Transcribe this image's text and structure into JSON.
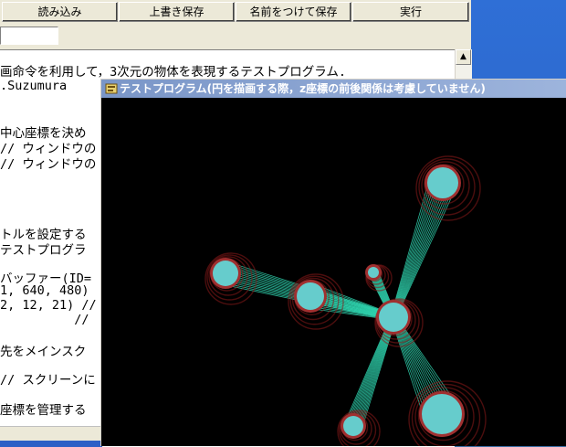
{
  "toolbar": {
    "load": "読み込み",
    "overwrite_save": "上書き保存",
    "save_as": "名前をつけて保存",
    "run": "実行"
  },
  "editor_lines": [
    "画命令を利用して，3次元の物体を表現するテストプログラム.",
    ".Suzumura",
    "",
    "",
    "中心座標を決め",
    "// ウィンドウの",
    "// ウィンドウの",
    "",
    "",
    "",
    "",
    "トルを設定する",
    "テストプログラ",
    "",
    "バッファー(ID=",
    "1, 640, 480)",
    "2, 12, 21) //",
    "          //",
    "",
    "先をメインスク",
    "",
    "// スクリーンに",
    "",
    "座標を管理する"
  ],
  "program_window": {
    "title": "テストプログラム(円を描画する際，z座標の前後関係は考慮していません)"
  },
  "icons": {
    "program": "program-icon",
    "scroll_up": "scroll-up-arrow-icon"
  },
  "colors": {
    "sphere_core": "#66cccc",
    "sphere_halo": "#8b1a1a",
    "lines": "#2fd6b0",
    "background": "#000000"
  }
}
